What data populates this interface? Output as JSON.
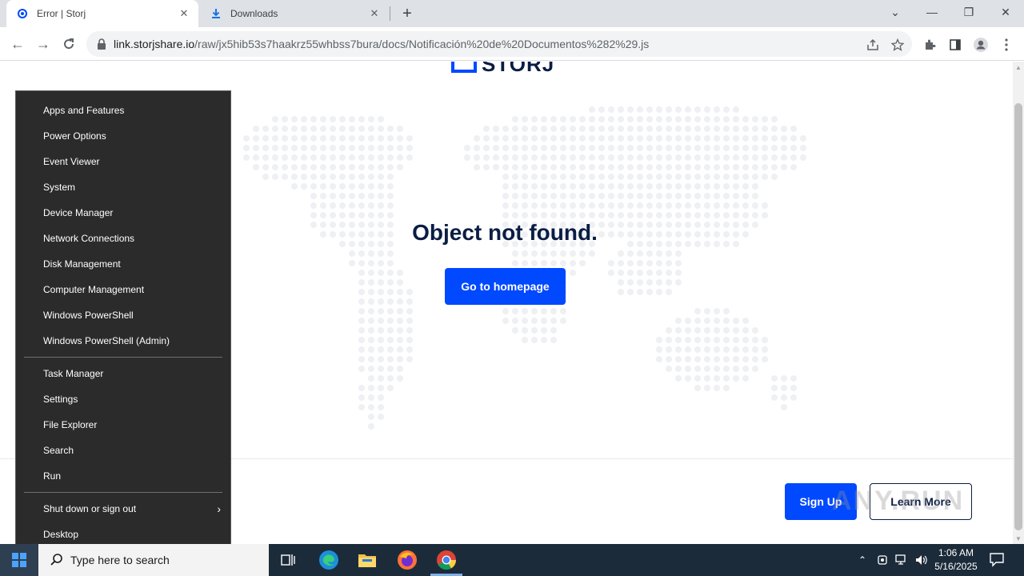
{
  "browser": {
    "tabs": [
      {
        "title": "Error | Storj",
        "icon": "storj-favicon",
        "active": true
      },
      {
        "title": "Downloads",
        "icon": "download-icon",
        "active": false
      }
    ],
    "url_host": "link.storjshare.io",
    "url_path": "/raw/jx5hib53s7haakrz55whbss7bura/docs/Notificación%20de%20Documentos%282%29.js"
  },
  "page": {
    "logo_text": "STORJ",
    "headline": "Object not found.",
    "home_button": "Go to homepage",
    "signup_button": "Sign Up",
    "learn_button": "Learn More",
    "watermark": "ANY.RUN",
    "accent_color": "#0149ff",
    "text_color": "#0a1d44"
  },
  "context_menu": {
    "items_group1": [
      "Apps and Features",
      "Power Options",
      "Event Viewer",
      "System",
      "Device Manager",
      "Network Connections",
      "Disk Management",
      "Computer Management",
      "Windows PowerShell",
      "Windows PowerShell (Admin)"
    ],
    "items_group2": [
      "Task Manager",
      "Settings",
      "File Explorer",
      "Search",
      "Run"
    ],
    "items_group3": [
      "Shut down or sign out",
      "Desktop"
    ]
  },
  "taskbar": {
    "search_placeholder": "Type here to search",
    "time": "1:06 AM",
    "date": "5/16/2025",
    "apps": [
      "task-view-icon",
      "edge-icon",
      "file-explorer-icon",
      "firefox-icon",
      "chrome-icon"
    ]
  }
}
